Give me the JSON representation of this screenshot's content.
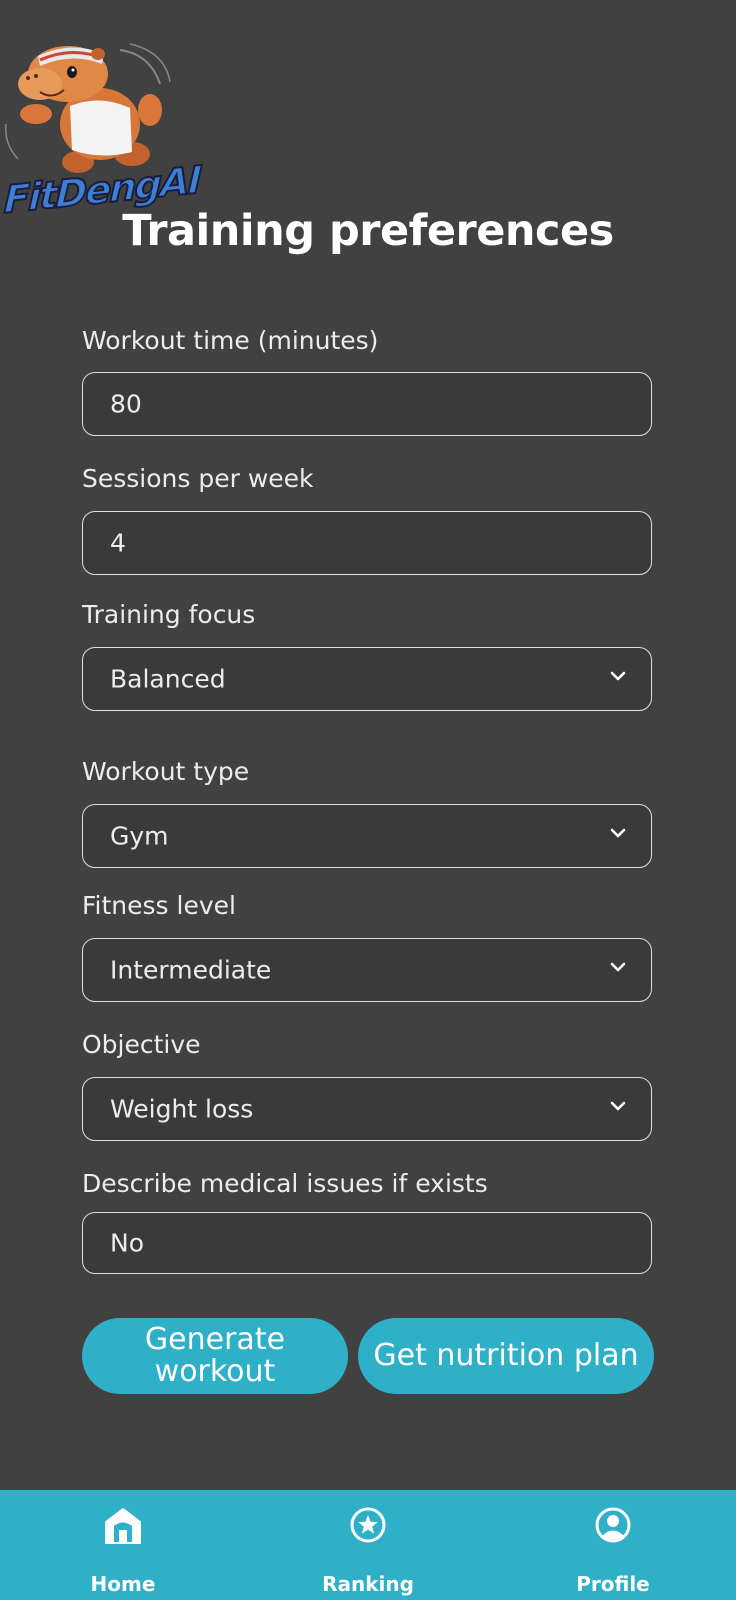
{
  "brand": {
    "logo_text": "FitDengAI"
  },
  "page": {
    "title": "Training preferences"
  },
  "form": {
    "workout_time": {
      "label": "Workout time (minutes)",
      "value": "80"
    },
    "sessions_per_week": {
      "label": "Sessions per week",
      "value": "4"
    },
    "training_focus": {
      "label": "Training focus",
      "value": "Balanced"
    },
    "workout_type": {
      "label": "Workout type",
      "value": "Gym"
    },
    "fitness_level": {
      "label": "Fitness level",
      "value": "Intermediate"
    },
    "objective": {
      "label": "Objective",
      "value": "Weight loss"
    },
    "medical_issues": {
      "label": "Describe medical issues if exists",
      "value": "No"
    }
  },
  "actions": {
    "generate_workout": "Generate workout",
    "get_nutrition_plan": "Get nutrition plan"
  },
  "nav": {
    "home": "Home",
    "ranking": "Ranking",
    "profile": "Profile"
  },
  "colors": {
    "background": "#414142",
    "accent": "#2fb0c9",
    "field_border": "#e0e0e0"
  }
}
